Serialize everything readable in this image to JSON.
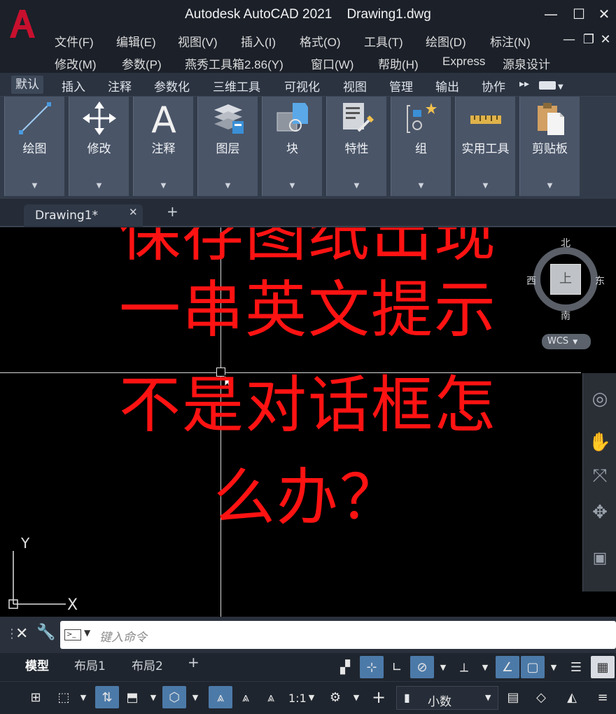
{
  "app": {
    "title": "Autodesk AutoCAD 2021",
    "file": "Drawing1.dwg",
    "brand_color": "#c8102e"
  },
  "window_controls": {
    "minimize": "—",
    "maximize": "☐",
    "close": "✕"
  },
  "menu": {
    "row1": [
      "文件(F)",
      "编辑(E)",
      "视图(V)",
      "插入(I)",
      "格式(O)",
      "工具(T)",
      "绘图(D)",
      "标注(N)"
    ],
    "row2": [
      "修改(M)",
      "参数(P)",
      "燕秀工具箱2.86(Y)",
      "窗口(W)",
      "帮助(H)",
      "Express",
      "源泉设计"
    ]
  },
  "ribbon_tabs": [
    "默认",
    "插入",
    "注释",
    "参数化",
    "三维工具",
    "可视化",
    "视图",
    "管理",
    "输出",
    "协作"
  ],
  "ribbon_overflow": "▸▸",
  "ribbon_panels": [
    {
      "label": "绘图",
      "icon": "line-icon"
    },
    {
      "label": "修改",
      "icon": "move-icon"
    },
    {
      "label": "注释",
      "icon": "text-icon"
    },
    {
      "label": "图层",
      "icon": "layers-icon"
    },
    {
      "label": "块",
      "icon": "block-icon"
    },
    {
      "label": "特性",
      "icon": "properties-icon"
    },
    {
      "label": "组",
      "icon": "group-icon"
    },
    {
      "label": "实用工具",
      "icon": "measure-icon"
    },
    {
      "label": "剪贴板",
      "icon": "clipboard-icon"
    }
  ],
  "doc_tab": {
    "label": "Drawing1*",
    "close": "✕",
    "new": "+"
  },
  "overlay": {
    "lines": [
      "保存图纸出现",
      "一串英文提示",
      "不是对话框怎",
      "么办？"
    ],
    "color": "#ff1212"
  },
  "viewcube": {
    "north": "北",
    "south": "南",
    "east": "东",
    "west": "西",
    "face": "上",
    "wcs": "WCS"
  },
  "ucs": {
    "x": "X",
    "y": "Y"
  },
  "command_line": {
    "placeholder": "键入命令"
  },
  "layout_tabs": [
    {
      "label": "模型",
      "active": true
    },
    {
      "label": "布局1",
      "active": false
    },
    {
      "label": "布局2",
      "active": false
    }
  ],
  "layout_add": "+",
  "status": {
    "scale": "1:1",
    "units": "小数"
  },
  "colors": {
    "canvas_bg": "#000000",
    "chrome_bg": "#1b2029",
    "ribbon_panel": "#4a5568",
    "toggle_on": "#4c7aa8"
  }
}
